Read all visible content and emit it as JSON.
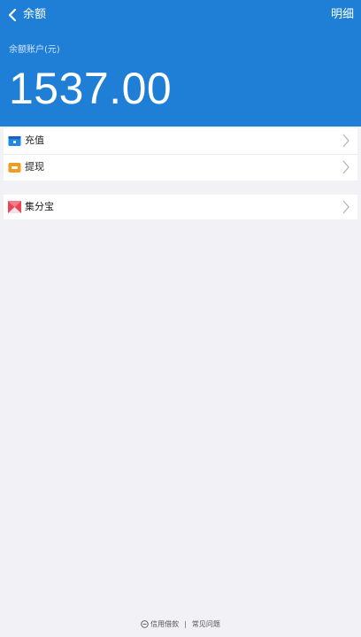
{
  "nav": {
    "title": "余额",
    "detail_label": "明细"
  },
  "balance": {
    "label": "余额账户(元)",
    "amount": "1537.00"
  },
  "menu_group1": [
    {
      "label": "充值",
      "icon": "wallet-icon",
      "color": "#1e88e5"
    },
    {
      "label": "提现",
      "icon": "withdraw-icon",
      "color": "#f29c1f"
    }
  ],
  "menu_group2": [
    {
      "label": "集分宝",
      "icon": "jifenbao-icon",
      "color": "#e8455a"
    }
  ],
  "footer": {
    "link1": "信用借款",
    "link2": "常见问题"
  },
  "colors": {
    "header_bg": "#1f7fd6",
    "page_bg": "#f2f2f6"
  }
}
